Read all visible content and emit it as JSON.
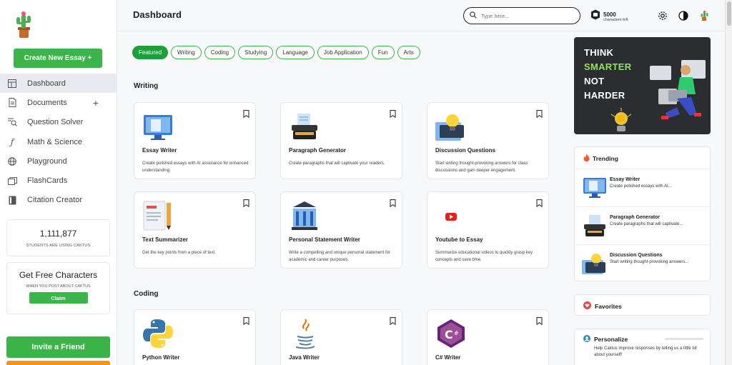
{
  "sidebar": {
    "create_label": "Create New Essay +",
    "items": [
      {
        "label": "Dashboard",
        "icon": "layout-icon"
      },
      {
        "label": "Documents",
        "icon": "document-icon"
      },
      {
        "label": "Question Solver",
        "icon": "search-list-icon"
      },
      {
        "label": "Math & Science",
        "icon": "function-icon"
      },
      {
        "label": "Playground",
        "icon": "globe-icon"
      },
      {
        "label": "FlashCards",
        "icon": "cards-icon"
      },
      {
        "label": "Citation Creator",
        "icon": "book-icon"
      }
    ],
    "documents_add": "+",
    "stat_number": "1,111,877",
    "stat_text": "STUDENTS ARE USING CAKTUS",
    "free_title": "Get Free Characters",
    "free_sub": "WHEN YOU POST ABOUT CAKTUS",
    "claim_label": "Claim",
    "invite_label": "Invite a Friend"
  },
  "header": {
    "title": "Dashboard",
    "search_placeholder": "Type here...",
    "chars_count": "5000",
    "chars_label": "characters left"
  },
  "filters": [
    "Featured",
    "Writing",
    "Coding",
    "Studying",
    "Language",
    "Job Application",
    "Fun",
    "Arts"
  ],
  "sections": {
    "writing": "Writing",
    "coding": "Coding"
  },
  "tools": [
    {
      "name": "Essay Writer",
      "desc": "Create polished essays with AI assistance for enhanced understanding."
    },
    {
      "name": "Paragraph Generator",
      "desc": "Create paragraphs that will captivate your readers."
    },
    {
      "name": "Discussion Questions",
      "desc": "Start writing thought-provoking answers for class discussions and gain deeper engagement."
    },
    {
      "name": "Text Summarizer",
      "desc": "Get the key points from a piece of text."
    },
    {
      "name": "Personal Statement Writer",
      "desc": "Write a compelling and unique personal statement for academic and career purposes."
    },
    {
      "name": "Youtube to Essay",
      "desc": "Summarize educational videos to quickly grasp key concepts and save time."
    },
    {
      "name": "Python Writer",
      "desc": ""
    },
    {
      "name": "Java Writer",
      "desc": ""
    },
    {
      "name": "C# Writer",
      "desc": ""
    }
  ],
  "banner": {
    "line1": "THINK",
    "line2": "SMARTER",
    "line3": "NOT",
    "line4": "HARDER"
  },
  "trending": {
    "title": "Trending",
    "items": [
      {
        "name": "Essay Writer",
        "desc": "Create polished essays with AI..."
      },
      {
        "name": "Paragraph Generator",
        "desc": "Create paragraphs that will captivate..."
      },
      {
        "name": "Discussion Questions",
        "desc": "Start writing thought-provoking answers..."
      }
    ]
  },
  "favorites": {
    "title": "Favorites"
  },
  "personalize": {
    "title": "Personalize",
    "desc": "Help Caktus improve responses by telling us a little bit about yourself!"
  },
  "colors": {
    "accent": "#3bb54a",
    "accent_dark": "#1f9f3a",
    "orange": "#f7941d",
    "banner_bg": "#2c2d31",
    "banner_green": "#8fe35a"
  }
}
